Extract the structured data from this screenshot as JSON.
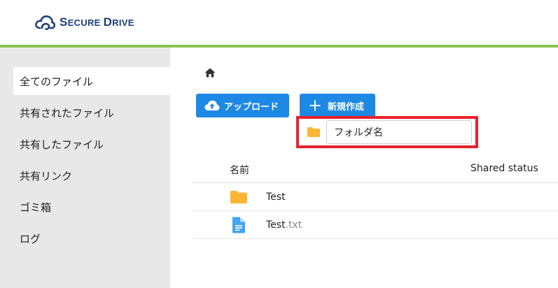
{
  "app": {
    "logo_text_first_cap": "S",
    "logo_text_first_rest": "ECURE",
    "logo_text_second_cap": "D",
    "logo_text_second_rest": "RIVE"
  },
  "colors": {
    "brand": "#1e3f7a",
    "accent_bar": "#8bc34a",
    "button": "#1e88e5",
    "highlight": "#e8202a",
    "folder": "#fbb534",
    "file": "#42a5f5"
  },
  "sidebar": {
    "items": [
      {
        "label": "全てのファイル",
        "active": true
      },
      {
        "label": "共有されたファイル",
        "active": false
      },
      {
        "label": "共有したファイル",
        "active": false
      },
      {
        "label": "共有リンク",
        "active": false
      },
      {
        "label": "ゴミ箱",
        "active": false
      },
      {
        "label": "ログ",
        "active": false
      }
    ]
  },
  "toolbar": {
    "home_icon": "home-icon",
    "upload_label": "アップロード",
    "new_label": "新規作成"
  },
  "new_folder": {
    "icon": "folder-icon",
    "value": "フォルダ名"
  },
  "table": {
    "columns": {
      "name": "名前",
      "shared": "Shared status"
    },
    "rows": [
      {
        "type": "folder",
        "icon": "folder-icon",
        "name": "Test",
        "ext": ""
      },
      {
        "type": "file",
        "icon": "text-file-icon",
        "name": "Test",
        "ext": ".txt"
      }
    ]
  }
}
